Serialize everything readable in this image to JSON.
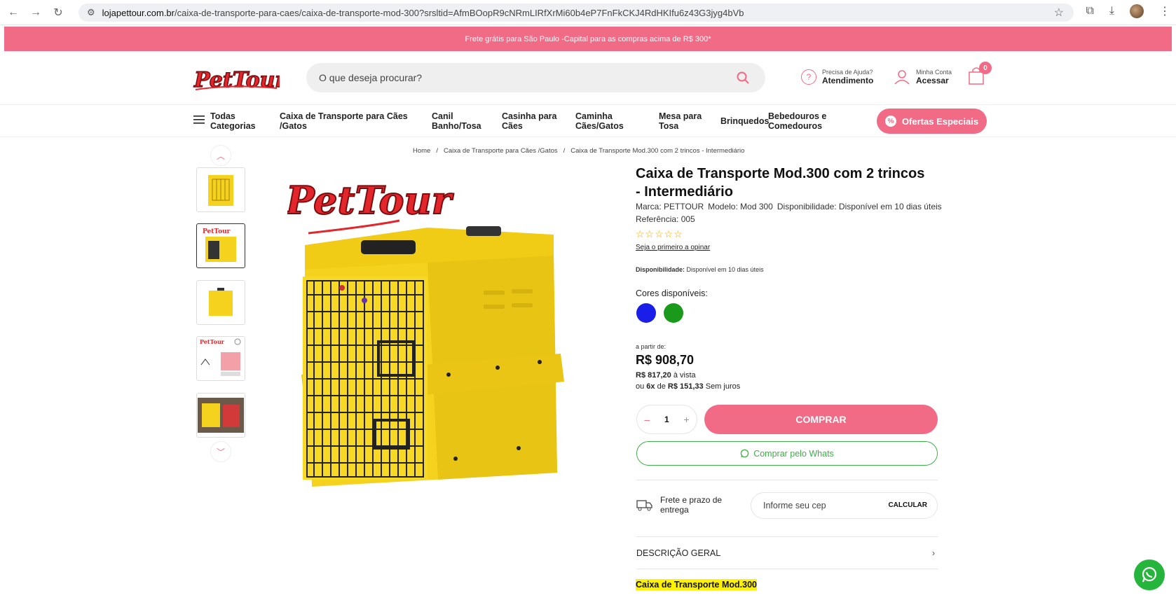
{
  "browser": {
    "url_host": "lojapettour.com.br",
    "url_path": "/caixa-de-transporte-para-caes/caixa-de-transporte-mod-300?srsltid=AfmBOopR9cNRmLIRfXrMi60b4eP7FnFkCKJ4RdHKIfu6z43G3jyg4bVb"
  },
  "promo": {
    "text": "Frete grátis para São Paulo -Capital para as compras acima de R$ 300*"
  },
  "header": {
    "logo_text": "PetTour",
    "search_placeholder": "O que deseja procurar?",
    "help_small": "Precisa de Ajuda?",
    "help_bold": "Atendimento",
    "account_small": "Minha Conta",
    "account_bold": "Acessar",
    "cart_count": "0"
  },
  "nav": {
    "all_categories_1": "Todas",
    "all_categories_2": "Categorias",
    "items": [
      {
        "line1": "Caixa de Transporte para Cães",
        "line2": "/Gatos"
      },
      {
        "line1": "Canil",
        "line2": "Banho/Tosa"
      },
      {
        "line1": "Casinha para",
        "line2": "Cães"
      },
      {
        "line1": "Caminha",
        "line2": "Cães/Gatos"
      },
      {
        "line1": "Mesa para",
        "line2": "Tosa"
      },
      {
        "line1": "Brinquedos",
        "line2": ""
      },
      {
        "line1": "Bebedouros e",
        "line2": "Comedouros"
      }
    ],
    "offers": "Ofertas Especiais"
  },
  "breadcrumb": {
    "home": "Home",
    "sep": "/",
    "category": "Caixa de Transporte para Cães /Gatos",
    "current": "Caixa de Transporte Mod.300 com 2 trincos - Intermediário"
  },
  "product": {
    "title": "Caixa de Transporte Mod.300 com 2 trincos - Intermediário",
    "brand": "Marca: PETTOUR",
    "model": "Modelo: Mod 300",
    "availability_meta": "Disponibilidade: Disponível em 10 dias úteis",
    "reference": "Referência: 005",
    "stars": "☆☆☆☆☆",
    "rating": 0,
    "review_link": "Seja o primeiro a opinar",
    "avail_label": "Disponibilidade:",
    "avail_value": " Disponível em 10 dias úteis",
    "colors_label": "Cores disponíveis:",
    "colors": [
      "#1a1ee8",
      "#1a9a1a"
    ],
    "price_from": "a partir de:",
    "price": "R$ 908,70",
    "cash_price": "R$ 817,20",
    "cash_suffix": " à vista",
    "inst_prefix": "ou ",
    "inst_count": "6x",
    "inst_de": " de ",
    "inst_value": "R$ 151,33",
    "inst_suffix": " Sem juros",
    "qty_minus": "–",
    "qty": "1",
    "qty_plus": "+",
    "buy": "COMPRAR",
    "whats": "Comprar pelo Whats",
    "ship_label": "Frete e prazo de entrega",
    "cep_placeholder": "Informe seu cep",
    "calc": "CALCULAR",
    "desc_title": "DESCRIÇÃO GERAL",
    "desc_heading": "Caixa de Transporte Mod.300"
  },
  "colors": {
    "brand_pink": "#f26b86",
    "whats_green": "#3fae49",
    "product_yellow": "#f5d21e"
  }
}
